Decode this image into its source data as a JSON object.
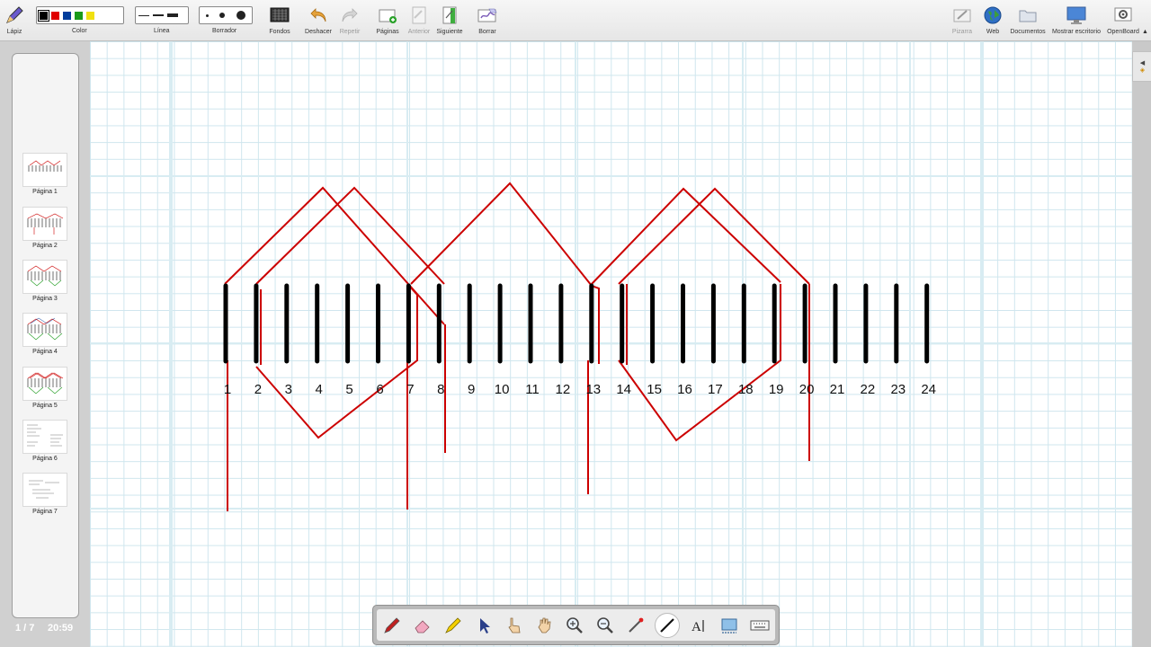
{
  "toolbar": {
    "pencil_label": "Lápiz",
    "color_label": "Color",
    "line_label": "Línea",
    "eraser_label": "Borrador",
    "backgrounds_label": "Fondos",
    "undo_label": "Deshacer",
    "redo_label": "Repetir",
    "pages_label": "Páginas",
    "previous_label": "Anterior",
    "next_label": "Siguiente",
    "clear_label": "Borrar",
    "board_label": "Pizarra",
    "web_label": "Web",
    "documents_label": "Documentos",
    "desktop_label": "Mostrar escritorio",
    "openboard_label": "OpenBoard"
  },
  "colors": {
    "swatches": [
      "#000000",
      "#e00000",
      "#003c9c",
      "#1a9a1a",
      "#f0e010"
    ],
    "selected": "#000000",
    "ink_red": "#cc0000"
  },
  "pages": [
    {
      "label": "Página 1"
    },
    {
      "label": "Página 2"
    },
    {
      "label": "Página 3"
    },
    {
      "label": "Página 4"
    },
    {
      "label": "Página 5"
    },
    {
      "label": "Página 6"
    },
    {
      "label": "Página 7"
    }
  ],
  "status": {
    "page_counter": "1 / 7",
    "clock": "20:59"
  },
  "board": {
    "slot_numbers": [
      "1",
      "2",
      "3",
      "4",
      "5",
      "6",
      "7",
      "8",
      "9",
      "10",
      "11",
      "12",
      "13",
      "14",
      "15",
      "16",
      "17",
      "18",
      "19",
      "20",
      "21",
      "22",
      "23",
      "24"
    ]
  },
  "bottom_tools": [
    {
      "name": "pen-tool",
      "icon": "pen-icon"
    },
    {
      "name": "eraser-tool",
      "icon": "eraser-icon"
    },
    {
      "name": "marker-tool",
      "icon": "marker-icon"
    },
    {
      "name": "select-tool",
      "icon": "arrow-icon"
    },
    {
      "name": "interact-tool",
      "icon": "pointing-hand-icon"
    },
    {
      "name": "hand-tool",
      "icon": "hand-icon"
    },
    {
      "name": "zoom-in-tool",
      "icon": "zoom-in-icon"
    },
    {
      "name": "zoom-out-tool",
      "icon": "zoom-out-icon"
    },
    {
      "name": "laser-tool",
      "icon": "laser-pointer-icon"
    },
    {
      "name": "line-tool",
      "icon": "line-icon"
    },
    {
      "name": "text-tool",
      "icon": "text-icon"
    },
    {
      "name": "capture-tool",
      "icon": "capture-icon"
    },
    {
      "name": "keyboard-tool",
      "icon": "keyboard-icon"
    }
  ]
}
